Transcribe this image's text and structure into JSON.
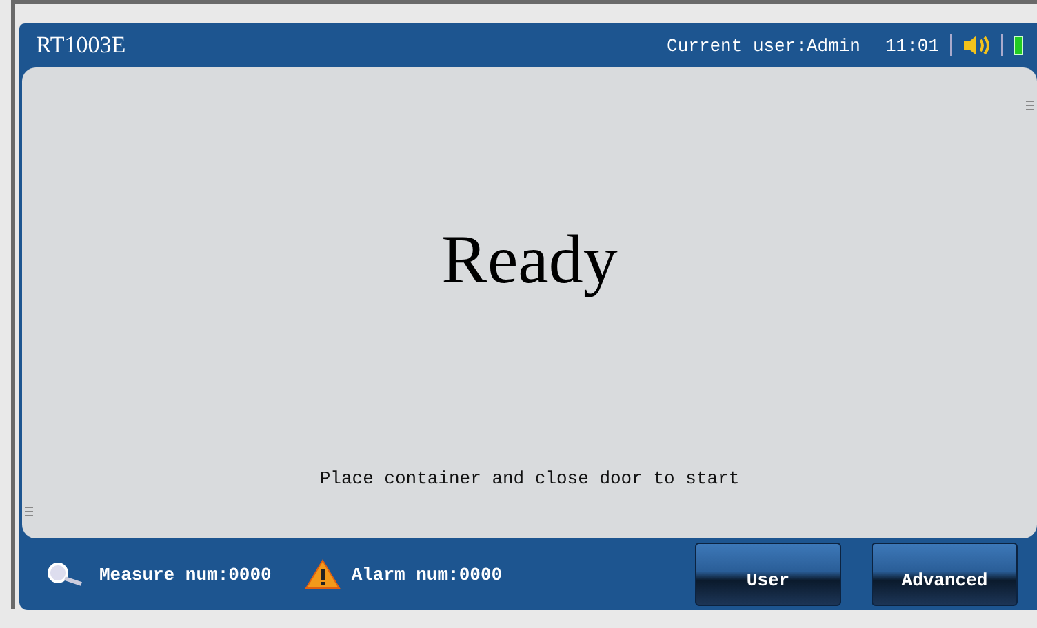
{
  "header": {
    "title": "RT1003E",
    "current_user": "Current user:Admin",
    "time": "11:01",
    "sound_on": true
  },
  "main": {
    "status": "Ready",
    "instruction": "Place container and close door to start"
  },
  "footer": {
    "measure": "Measure num:0000",
    "alarm": "Alarm num:0000",
    "buttons": [
      "User",
      "Advanced"
    ]
  }
}
